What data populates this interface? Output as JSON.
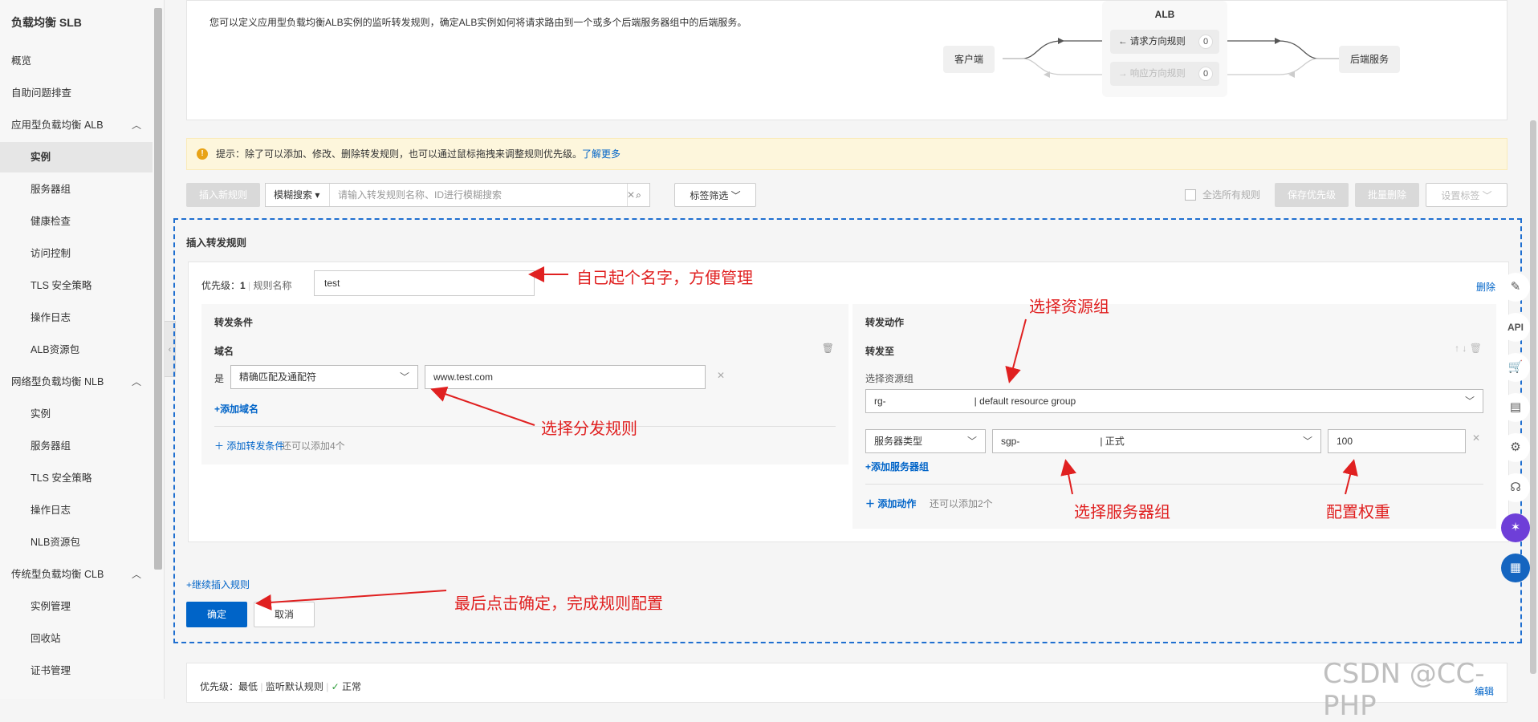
{
  "sidebar": {
    "title": "负载均衡 SLB",
    "items": [
      {
        "label": "概览"
      },
      {
        "label": "自助问题排查"
      },
      {
        "label": "应用型负载均衡 ALB"
      },
      {
        "label": "实例"
      },
      {
        "label": "服务器组"
      },
      {
        "label": "健康检查"
      },
      {
        "label": "访问控制"
      },
      {
        "label": "TLS 安全策略"
      },
      {
        "label": "操作日志"
      },
      {
        "label": "ALB资源包"
      },
      {
        "label": "网络型负载均衡 NLB"
      },
      {
        "label": "实例"
      },
      {
        "label": "服务器组"
      },
      {
        "label": "TLS 安全策略"
      },
      {
        "label": "操作日志"
      },
      {
        "label": "NLB资源包"
      },
      {
        "label": "传统型负载均衡 CLB"
      },
      {
        "label": "实例管理"
      },
      {
        "label": "回收站"
      },
      {
        "label": "证书管理"
      }
    ]
  },
  "intro": {
    "description": "您可以定义应用型负载均衡ALB实例的监听转发规则，确定ALB实例如何将请求路由到一个或多个后端服务器组中的后端服务。",
    "client": "客户端",
    "alb": "ALB",
    "request_rule": "请求方向规则",
    "request_count": "0",
    "response_rule": "响应方向规则",
    "response_count": "0",
    "backend": "后端服务"
  },
  "tip": {
    "text": "提示：除了可以添加、修改、删除转发规则，也可以通过鼠标拖拽来调整规则优先级。",
    "link": "了解更多"
  },
  "toolbar": {
    "insert_rule": "插入新规则",
    "search_mode": "模糊搜索",
    "search_placeholder": "请输入转发规则名称、ID进行模糊搜索",
    "tag_filter": "标签筛选",
    "select_all": "全选所有规则",
    "save_priority": "保存优先级",
    "batch_delete": "批量删除",
    "set_tag": "设置标签"
  },
  "form": {
    "title": "插入转发规则",
    "priority_label": "优先级：",
    "priority_value": "1",
    "rule_name_label": "规则名称",
    "rule_name_value": "test",
    "delete": "删除",
    "conditions_title": "转发条件",
    "domain_label": "域名",
    "is_label": "是",
    "match_type": "精确匹配及通配符",
    "domain_value": "www.test.com",
    "add_domain": "添加域名",
    "add_condition": "添加转发条件",
    "condition_remaining": "还可以添加4个",
    "actions_title": "转发动作",
    "forward_to": "转发至",
    "resource_group_label": "选择资源组",
    "resource_group_prefix": "rg-",
    "resource_group_value": "| default resource group",
    "server_type": "服务器类型",
    "server_group_prefix": "sgp-",
    "server_group_value": "| 正式",
    "weight": "100",
    "add_server_group": "添加服务器组",
    "add_action": "添加动作",
    "action_remaining": "还可以添加2个",
    "continue_insert": "继续插入规则",
    "confirm": "确定",
    "cancel": "取消"
  },
  "bottom_rule": {
    "priority_label": "优先级：",
    "priority_value": "最低",
    "name": "监听默认规则",
    "status": "正常",
    "edit": "编辑"
  },
  "annotations": {
    "name_hint": "自己起个名字，方便管理",
    "resource_group_hint": "选择资源组",
    "dispatch_hint": "选择分发规则",
    "server_group_hint": "选择服务器组",
    "weight_hint": "配置权重",
    "confirm_hint": "最后点击确定，完成规则配置"
  },
  "watermark": "CSDN @CC-PHP",
  "colors": {
    "primary": "#0064c8",
    "annotation": "#e02020",
    "tip_bg": "#fdf6dc"
  }
}
